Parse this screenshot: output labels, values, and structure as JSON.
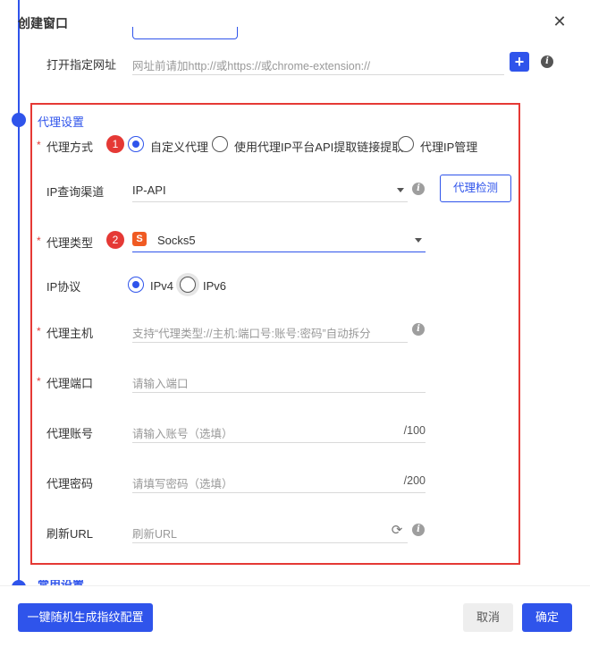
{
  "dialog": {
    "title": "创建窗口"
  },
  "open_url": {
    "label": "打开指定网址",
    "placeholder": "网址前请加http://或https://或chrome-extension://"
  },
  "proxy": {
    "section_title": "代理设置",
    "mode": {
      "label": "代理方式",
      "badge": "1",
      "options": [
        "自定义代理",
        "使用代理IP平台API提取链接提取",
        "代理IP管理"
      ],
      "selected": "自定义代理"
    },
    "ip_channel": {
      "label": "IP查询渠道",
      "value": "IP-API",
      "check_button": "代理检测"
    },
    "proxy_type": {
      "label": "代理类型",
      "badge": "2",
      "logo": "S",
      "value": "Socks5"
    },
    "ip_protocol": {
      "label": "IP协议",
      "options": [
        "IPv4",
        "IPv6"
      ],
      "selected": "IPv4"
    },
    "host": {
      "label": "代理主机",
      "placeholder": "支持“代理类型://主机:端口号:账号:密码”自动拆分"
    },
    "port": {
      "label": "代理端口",
      "placeholder": "请输入端口"
    },
    "account": {
      "label": "代理账号",
      "placeholder": "请输入账号（选填）",
      "counter": "/100"
    },
    "password": {
      "label": "代理密码",
      "placeholder": "请填写密码（选填）",
      "counter": "/200"
    },
    "refresh_url": {
      "label": "刷新URL",
      "placeholder": "刷新URL"
    }
  },
  "footer": {
    "generate_button": "一键随机生成指纹配置",
    "cancel_button": "取消",
    "confirm_button": "确定"
  },
  "colors": {
    "accent": "#2f54eb",
    "highlight": "#e53935"
  }
}
